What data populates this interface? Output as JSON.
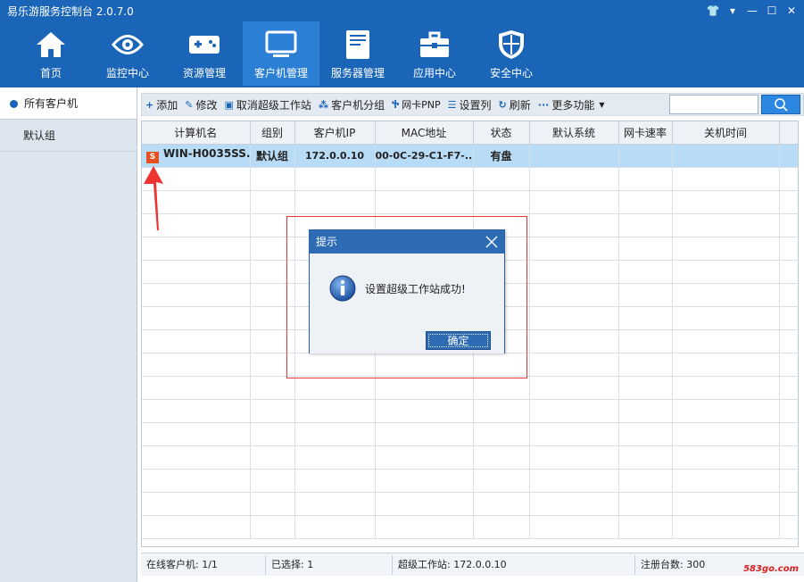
{
  "app": {
    "title": "易乐游服务控制台 2.0.7.0"
  },
  "window_controls": [
    {
      "name": "shirt-icon",
      "glyph": "👕"
    },
    {
      "name": "chevron-down-icon",
      "glyph": "▾"
    },
    {
      "name": "minimize-icon",
      "glyph": "—"
    },
    {
      "name": "maximize-icon",
      "glyph": "☐"
    },
    {
      "name": "close-icon",
      "glyph": "✕"
    }
  ],
  "nav": {
    "items": [
      {
        "label": "首页",
        "icon": "home-icon"
      },
      {
        "label": "监控中心",
        "icon": "eye-icon"
      },
      {
        "label": "资源管理",
        "icon": "gamepad-icon"
      },
      {
        "label": "客户机管理",
        "icon": "monitor-icon",
        "active": true
      },
      {
        "label": "服务器管理",
        "icon": "server-icon"
      },
      {
        "label": "应用中心",
        "icon": "briefcase-icon"
      },
      {
        "label": "安全中心",
        "icon": "shield-icon"
      }
    ]
  },
  "sidebar": {
    "items": [
      {
        "label": "所有客户机",
        "active": true
      },
      {
        "label": "默认组"
      }
    ]
  },
  "toolbar": {
    "add": "添加",
    "edit": "修改",
    "cancel_super": "取消超级工作站",
    "group": "客户机分组",
    "pnp": "网卡PNP",
    "columns": "设置列",
    "refresh": "刷新",
    "more": "更多功能",
    "search_value": ""
  },
  "table": {
    "columns": [
      "计算机名",
      "组别",
      "客户机IP",
      "MAC地址",
      "状态",
      "默认系统",
      "网卡速率",
      "关机时间"
    ],
    "rows": [
      [
        "WIN-H0035SS...",
        "默认组",
        "172.0.0.10",
        "00-0C-29-C1-F7-...",
        "有盘",
        "",
        "",
        ""
      ]
    ],
    "pc_icon_letter": "S"
  },
  "statusbar": {
    "online": "在线客户机: 1/1",
    "selected": "已选择: 1",
    "super_station": "超级工作站: 172.0.0.10",
    "registered": "注册台数: 300"
  },
  "dialog": {
    "title": "提示",
    "message": "设置超级工作站成功!",
    "ok": "确定"
  },
  "watermark": "583go.com",
  "colors": {
    "header_blue": "#1a65b8",
    "active_nav": "#2b7fd4",
    "selected_row": "#b9dcf6",
    "annotation_red": "#e33333"
  }
}
